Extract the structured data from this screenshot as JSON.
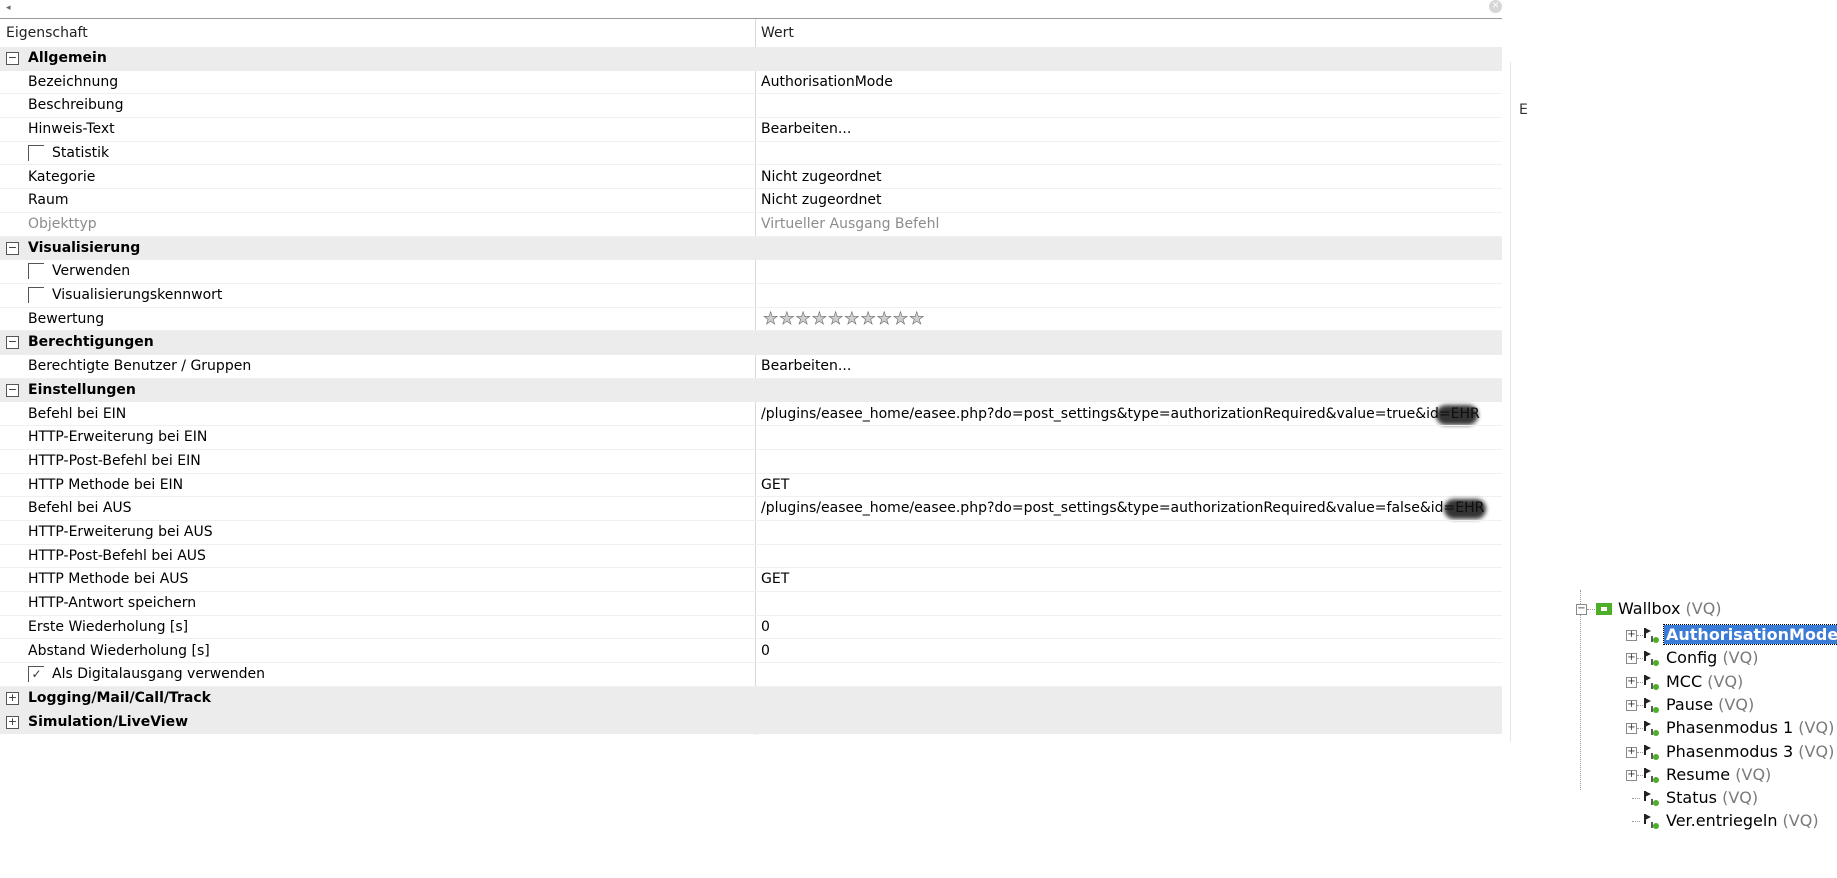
{
  "grid": {
    "header": {
      "property": "Eigenschaft",
      "value": "Wert"
    },
    "rows": [
      {
        "type": "cat",
        "expander": "−",
        "key": "Allgemein",
        "value": ""
      },
      {
        "type": "prop",
        "key": "Bezeichnung",
        "value": "AuthorisationMode"
      },
      {
        "type": "prop",
        "key": "Beschreibung",
        "value": ""
      },
      {
        "type": "prop",
        "key": "Hinweis-Text",
        "value": "Bearbeiten..."
      },
      {
        "type": "check",
        "checked": false,
        "key": "Statistik",
        "value": ""
      },
      {
        "type": "prop",
        "key": "Kategorie",
        "value": "Nicht zugeordnet"
      },
      {
        "type": "prop",
        "key": "Raum",
        "value": "Nicht zugeordnet"
      },
      {
        "type": "gray",
        "key": "Objekttyp",
        "value": "Virtueller Ausgang Befehl"
      },
      {
        "type": "cat",
        "expander": "−",
        "key": "Visualisierung",
        "value": ""
      },
      {
        "type": "check",
        "checked": false,
        "key": "Verwenden",
        "value": ""
      },
      {
        "type": "check",
        "checked": false,
        "key": "Visualisierungskennwort",
        "value": ""
      },
      {
        "type": "rating",
        "key": "Bewertung",
        "value": "",
        "rating": 0,
        "max": 10
      },
      {
        "type": "cat",
        "expander": "−",
        "key": "Berechtigungen",
        "value": ""
      },
      {
        "type": "prop",
        "key": "Berechtigte Benutzer / Gruppen",
        "value": "Bearbeiten..."
      },
      {
        "type": "cat",
        "expander": "−",
        "key": "Einstellungen",
        "value": ""
      },
      {
        "type": "prop",
        "key": "Befehl bei EIN",
        "value": "/plugins/easee_home/easee.php?do=post_settings&type=authorizationRequired&value=true&id=EHR",
        "redacted": true
      },
      {
        "type": "prop",
        "key": "HTTP-Erweiterung bei EIN",
        "value": ""
      },
      {
        "type": "prop",
        "key": "HTTP-Post-Befehl bei EIN",
        "value": ""
      },
      {
        "type": "prop",
        "key": "HTTP Methode bei EIN",
        "value": "GET"
      },
      {
        "type": "prop",
        "key": "Befehl bei AUS",
        "value": "/plugins/easee_home/easee.php?do=post_settings&type=authorizationRequired&value=false&id=EHR",
        "redacted": true
      },
      {
        "type": "prop",
        "key": "HTTP-Erweiterung bei AUS",
        "value": ""
      },
      {
        "type": "prop",
        "key": "HTTP-Post-Befehl bei AUS",
        "value": ""
      },
      {
        "type": "prop",
        "key": "HTTP Methode bei AUS",
        "value": "GET"
      },
      {
        "type": "prop",
        "key": "HTTP-Antwort speichern",
        "value": ""
      },
      {
        "type": "prop",
        "key": "Erste Wiederholung [s]",
        "value": "0"
      },
      {
        "type": "prop",
        "key": "Abstand Wiederholung [s]",
        "value": "0"
      },
      {
        "type": "check",
        "checked": true,
        "key": "Als Digitalausgang verwenden",
        "value": ""
      },
      {
        "type": "cat",
        "expander": "+",
        "key": "Logging/Mail/Call/Track",
        "value": ""
      },
      {
        "type": "cat",
        "expander": "+",
        "key": "Simulation/LiveView",
        "value": ""
      }
    ]
  },
  "tree": {
    "root": {
      "label": "Wallbox",
      "suffix": "(VQ)",
      "expander": "−"
    },
    "children": [
      {
        "label": "AuthorisationMode",
        "suffix": "",
        "selected": true,
        "expander": "+"
      },
      {
        "label": "Config",
        "suffix": "(VQ)",
        "expander": "+"
      },
      {
        "label": "MCC",
        "suffix": "(VQ)",
        "expander": "+"
      },
      {
        "label": "Pause",
        "suffix": "(VQ)",
        "expander": "+"
      },
      {
        "label": "Phasenmodus 1",
        "suffix": "(VQ)",
        "expander": "+"
      },
      {
        "label": "Phasenmodus 3",
        "suffix": "(VQ)",
        "expander": "+"
      },
      {
        "label": "Resume",
        "suffix": "(VQ)",
        "expander": "+"
      },
      {
        "label": "Status",
        "suffix": "(VQ)",
        "expander": ""
      },
      {
        "label": "Ver.entriegeln",
        "suffix": "(VQ)",
        "expander": ""
      }
    ]
  },
  "edge_glyph": "E",
  "colors": {
    "category_bg": "#ececec",
    "selection": "#3a7bd5",
    "tree_icon_green": "#4caf27"
  }
}
